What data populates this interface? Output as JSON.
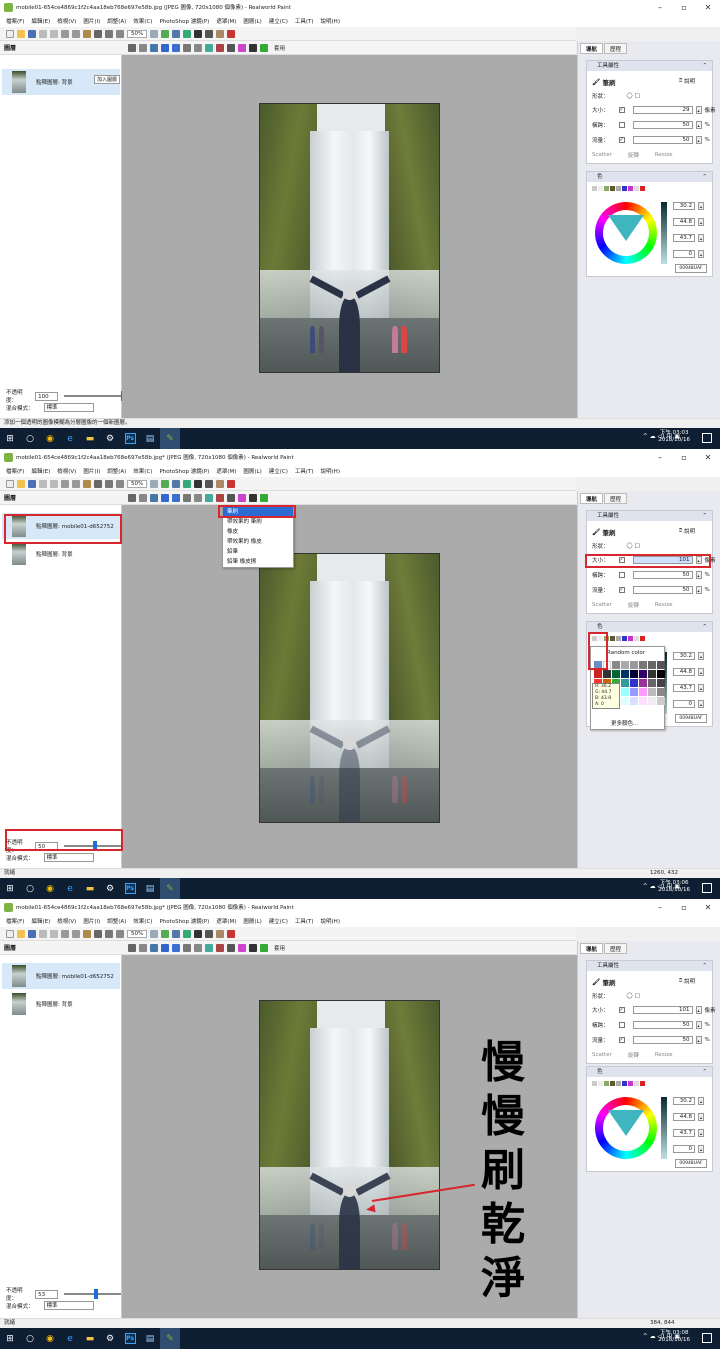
{
  "frames": [
    {
      "window_title": "mobile01-654ce4869c1f2c4aa18eb768e697e58b.jpg (JPEG 圖像, 720x1080 個像素) - Realworld Paint",
      "layers": [
        {
          "name": "點陣圖層: 背景",
          "selected": true
        }
      ],
      "tooltip": "加入圖層",
      "opacity": "100",
      "blend_mode": "標準",
      "status": "添加一個透明的圖像模糊為分層圖像的一個新圖層。",
      "coords": "",
      "brush_size": "29",
      "clock_time": "下午 03:03",
      "clock_date": "2018/10/16",
      "apply_label": "套用"
    },
    {
      "window_title": "mobile01-654ce4869c1f2c4aa18eb768e697e58b.jpg* (JPEG 圖像, 720x1080 個像素) - Realworld Paint",
      "layers": [
        {
          "name": "點陣圖層: mobile01-d652752",
          "selected": true
        },
        {
          "name": "點陣圖層: 背景",
          "selected": false
        }
      ],
      "tooltip": "",
      "opacity": "50",
      "blend_mode": "標準",
      "status": "就緒",
      "coords": "1260, 432",
      "brush_size": "101",
      "clock_time": "下午 03:06",
      "clock_date": "2018/10/16",
      "apply_label": ""
    },
    {
      "window_title": "mobile01-654ce4869c1f2c4aa18eb768e697e58b.jpg* (JPEG 圖像, 720x1080 個像素) - Realworld Paint",
      "layers": [
        {
          "name": "點陣圖層: mobile01-d652752",
          "selected": true
        },
        {
          "name": "點陣圖層: 背景",
          "selected": false
        }
      ],
      "tooltip": "",
      "opacity": "53",
      "blend_mode": "標準",
      "status": "就緒",
      "coords": "384, 844",
      "brush_size": "101",
      "clock_time": "下午 03:08",
      "clock_date": "2018/10/16",
      "apply_label": "套用"
    }
  ],
  "menu": [
    "檔案(F)",
    "編輯(E)",
    "檢視(V)",
    "圖片(I)",
    "調整(A)",
    "效果(C)",
    "PhotoShop 濾鏡(P)",
    "遮罩(M)",
    "圖層(L)",
    "建立(C)",
    "工具(T)",
    "說明(H)"
  ],
  "toolbar": {
    "zoom": "50%"
  },
  "layers_panel": {
    "title": "圖層"
  },
  "opacity_label": "不透明度：",
  "blend_label": "混合模式：",
  "right_tabs": [
    "導航",
    "歷程"
  ],
  "tool_props": {
    "header": "工具屬性",
    "tool_name": "筆刷",
    "help": "說明",
    "shape_label": "形狀：",
    "size_label": "大小：",
    "size_unit": "像素",
    "hardness_label": "橫跨：",
    "hardness_value": "50",
    "flow_label": "流量：",
    "flow_value": "50",
    "percent": "%",
    "scatter": "Scatter",
    "rotate": "旋轉",
    "resize": "Resize"
  },
  "color_panel": {
    "header": "色",
    "h": "30.2",
    "s": "44.8",
    "v": "43.7",
    "a": "0",
    "hex": "00948UAF"
  },
  "brush_menu": [
    "筆刷",
    "帶效果的 筆刷",
    "橡皮",
    "帶效果的 橡皮",
    "鉛筆",
    "鉛筆 橡皮擦"
  ],
  "color_popup": {
    "random": "Random color",
    "rgb": [
      "R: 30.2",
      "G: 44.7",
      "B: 43.8",
      "A: 0"
    ],
    "more": "更多顏色..."
  },
  "callout_text": [
    "慢",
    "慢",
    "刷",
    "乾",
    "淨"
  ],
  "colors": {
    "accent": "#1e6fd0",
    "annotation": "#d7262e",
    "taskbar": "#0f1f33"
  }
}
